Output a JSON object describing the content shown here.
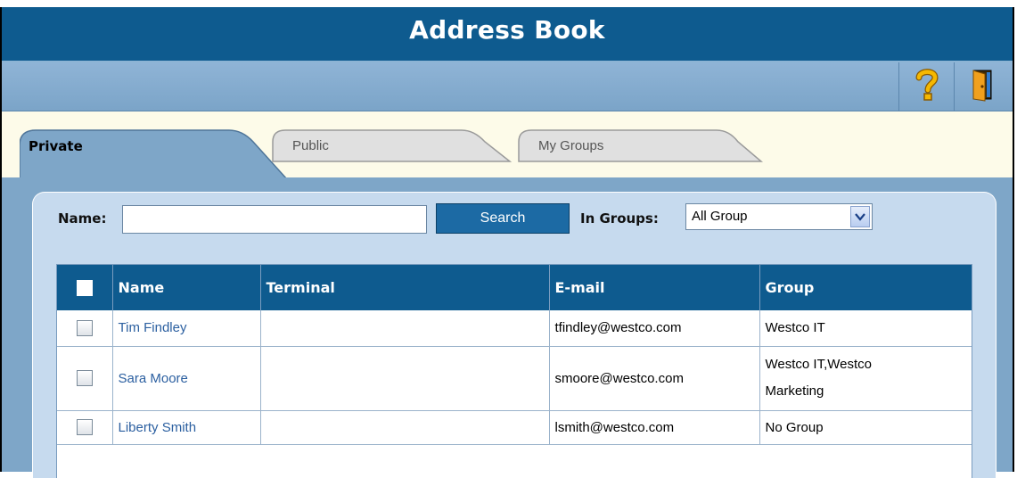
{
  "window": {
    "title": "Address Book"
  },
  "toolbar": {
    "help_icon": "question-mark-icon",
    "exit_icon": "exit-door-icon"
  },
  "tabs": [
    {
      "label": "Private",
      "active": true
    },
    {
      "label": "Public",
      "active": false
    },
    {
      "label": "My Groups",
      "active": false
    }
  ],
  "search": {
    "name_label": "Name:",
    "name_value": "",
    "button_label": "Search",
    "groups_label": "In Groups:",
    "groups_selected": "All Group"
  },
  "table": {
    "headers": [
      "Name",
      "Terminal",
      "E-mail",
      "Group"
    ],
    "rows": [
      {
        "name": "Tim Findley",
        "terminal": "",
        "email": "tfindley@westco.com",
        "group_line1": "Westco IT",
        "group_line2": ""
      },
      {
        "name": "Sara Moore",
        "terminal": "",
        "email": "smoore@westco.com",
        "group_line1": "Westco IT,Westco",
        "group_line2": "Marketing"
      },
      {
        "name": "Liberty Smith",
        "terminal": "",
        "email": "lsmith@westco.com",
        "group_line1": "No Group",
        "group_line2": ""
      }
    ]
  },
  "colors": {
    "header_blue": "#0e5b8f",
    "toolbar_blue": "#7ba4c8",
    "panel": "#c6daee",
    "tab_area": "#fdfbe9"
  }
}
